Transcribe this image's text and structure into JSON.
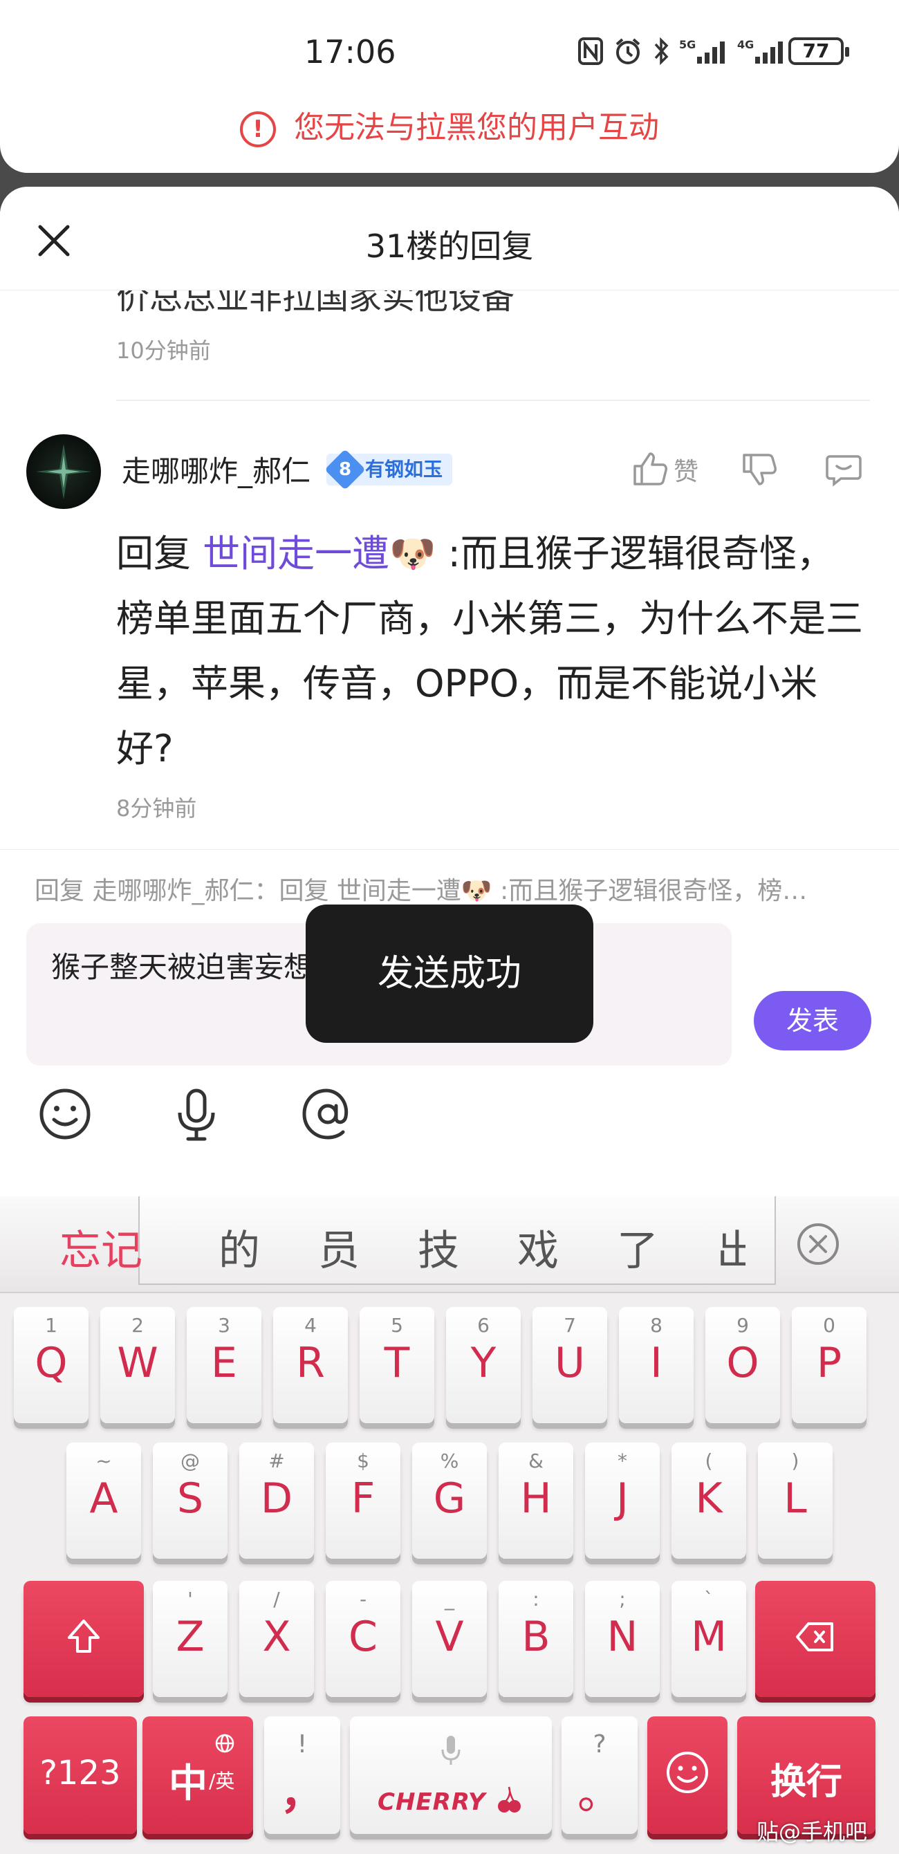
{
  "status_bar": {
    "time": "17:06",
    "battery": "77"
  },
  "block_notice": {
    "text": "您无法与拉黑您的用户互动"
  },
  "sheet": {
    "title": "31楼的回复",
    "prev_reply_tail": "价总总业非拉国家实他设备",
    "prev_reply_time": "10分钟前"
  },
  "reply": {
    "username": "走哪哪炸_郝仁",
    "badge_level": "8",
    "badge_text": "有钢如玉",
    "like_label": "赞",
    "prefix": "回复",
    "mention": "世间走一遭🐶",
    "content": ":而且猴子逻辑很奇怪，榜单里面五个厂商，小米第三，为什么不是三星，苹果，传音，OPPO，而是不能说小米好?",
    "time": "8分钟前"
  },
  "compose": {
    "reply_to": "回复 走哪哪炸_郝仁：回复 世间走一遭🐶 :而且猴子逻辑很奇怪，榜…",
    "input_text": "猴子整天被迫害妄想症犯了白演",
    "post_label": "发表",
    "tools": [
      "emoji-icon",
      "microphone-icon",
      "at-icon"
    ]
  },
  "toast": {
    "text": "发送成功"
  },
  "keyboard": {
    "candidates": [
      "忘记",
      "的",
      "员",
      "技",
      "戏",
      "了",
      "出"
    ],
    "row1": [
      {
        "n": "1",
        "l": "Q"
      },
      {
        "n": "2",
        "l": "W"
      },
      {
        "n": "3",
        "l": "E"
      },
      {
        "n": "4",
        "l": "R"
      },
      {
        "n": "5",
        "l": "T"
      },
      {
        "n": "6",
        "l": "Y"
      },
      {
        "n": "7",
        "l": "U"
      },
      {
        "n": "8",
        "l": "I"
      },
      {
        "n": "9",
        "l": "O"
      },
      {
        "n": "0",
        "l": "P"
      }
    ],
    "row2": [
      {
        "n": "~",
        "l": "A"
      },
      {
        "n": "@",
        "l": "S"
      },
      {
        "n": "#",
        "l": "D"
      },
      {
        "n": "$",
        "l": "F"
      },
      {
        "n": "%",
        "l": "G"
      },
      {
        "n": "&",
        "l": "H"
      },
      {
        "n": "*",
        "l": "J"
      },
      {
        "n": "(",
        "l": "K"
      },
      {
        "n": ")",
        "l": "L"
      }
    ],
    "row3": [
      {
        "n": "'",
        "l": "Z"
      },
      {
        "n": "/",
        "l": "X"
      },
      {
        "n": "-",
        "l": "C"
      },
      {
        "n": "_",
        "l": "V"
      },
      {
        "n": ":",
        "l": "B"
      },
      {
        "n": ";",
        "l": "N"
      },
      {
        "n": "`",
        "l": "M"
      }
    ],
    "sym_label": "?123",
    "lang_label": "中",
    "lang_sub": "/英",
    "comma_top": "!",
    "comma": "，",
    "space_brand": "CHERRY",
    "period_top": "?",
    "period": "。",
    "enter_label": "换行"
  },
  "watermark": "贴@手机吧"
}
